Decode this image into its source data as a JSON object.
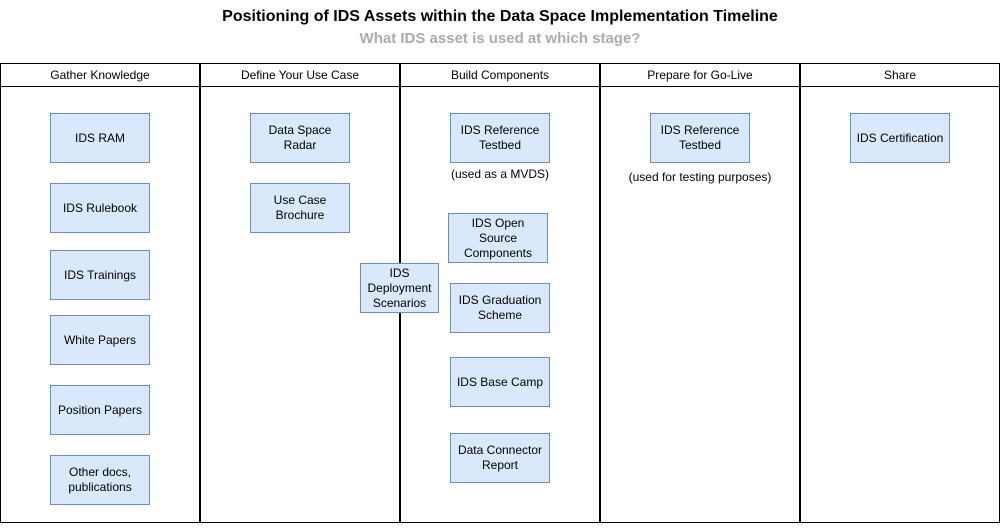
{
  "title": "Positioning of IDS Assets within the Data Space Implementation Timeline",
  "subtitle": "What IDS asset is used at which stage?",
  "lanes": [
    {
      "label": "Gather Knowledge"
    },
    {
      "label": "Define Your Use Case"
    },
    {
      "label": "Build Components"
    },
    {
      "label": "Prepare for Go-Live"
    },
    {
      "label": "Share"
    }
  ],
  "gather_knowledge": {
    "ram": "IDS RAM",
    "rulebook": "IDS Rulebook",
    "trainings": "IDS Trainings",
    "white_papers": "White Papers",
    "position_papers": "Position Papers",
    "other_docs": "Other docs, publications"
  },
  "define_use_case": {
    "radar": "Data Space Radar",
    "brochure": "Use Case Brochure"
  },
  "deployment_scenarios": "IDS Deployment Scenarios",
  "build_components": {
    "testbed": "IDS Reference Testbed",
    "testbed_note": "(used as a MVDS)",
    "open_source": "IDS Open Source Components",
    "graduation": "IDS Graduation Scheme",
    "base_camp": "IDS Base Camp",
    "connector_report": "Data Connector Report"
  },
  "prepare_go_live": {
    "testbed": "IDS Reference Testbed",
    "testbed_note": "(used for testing purposes)"
  },
  "share": {
    "certification": "IDS Certification"
  },
  "colors": {
    "box_fill": "#dae8fc",
    "box_border": "#6c8ebf",
    "subtitle": "#ababab"
  }
}
